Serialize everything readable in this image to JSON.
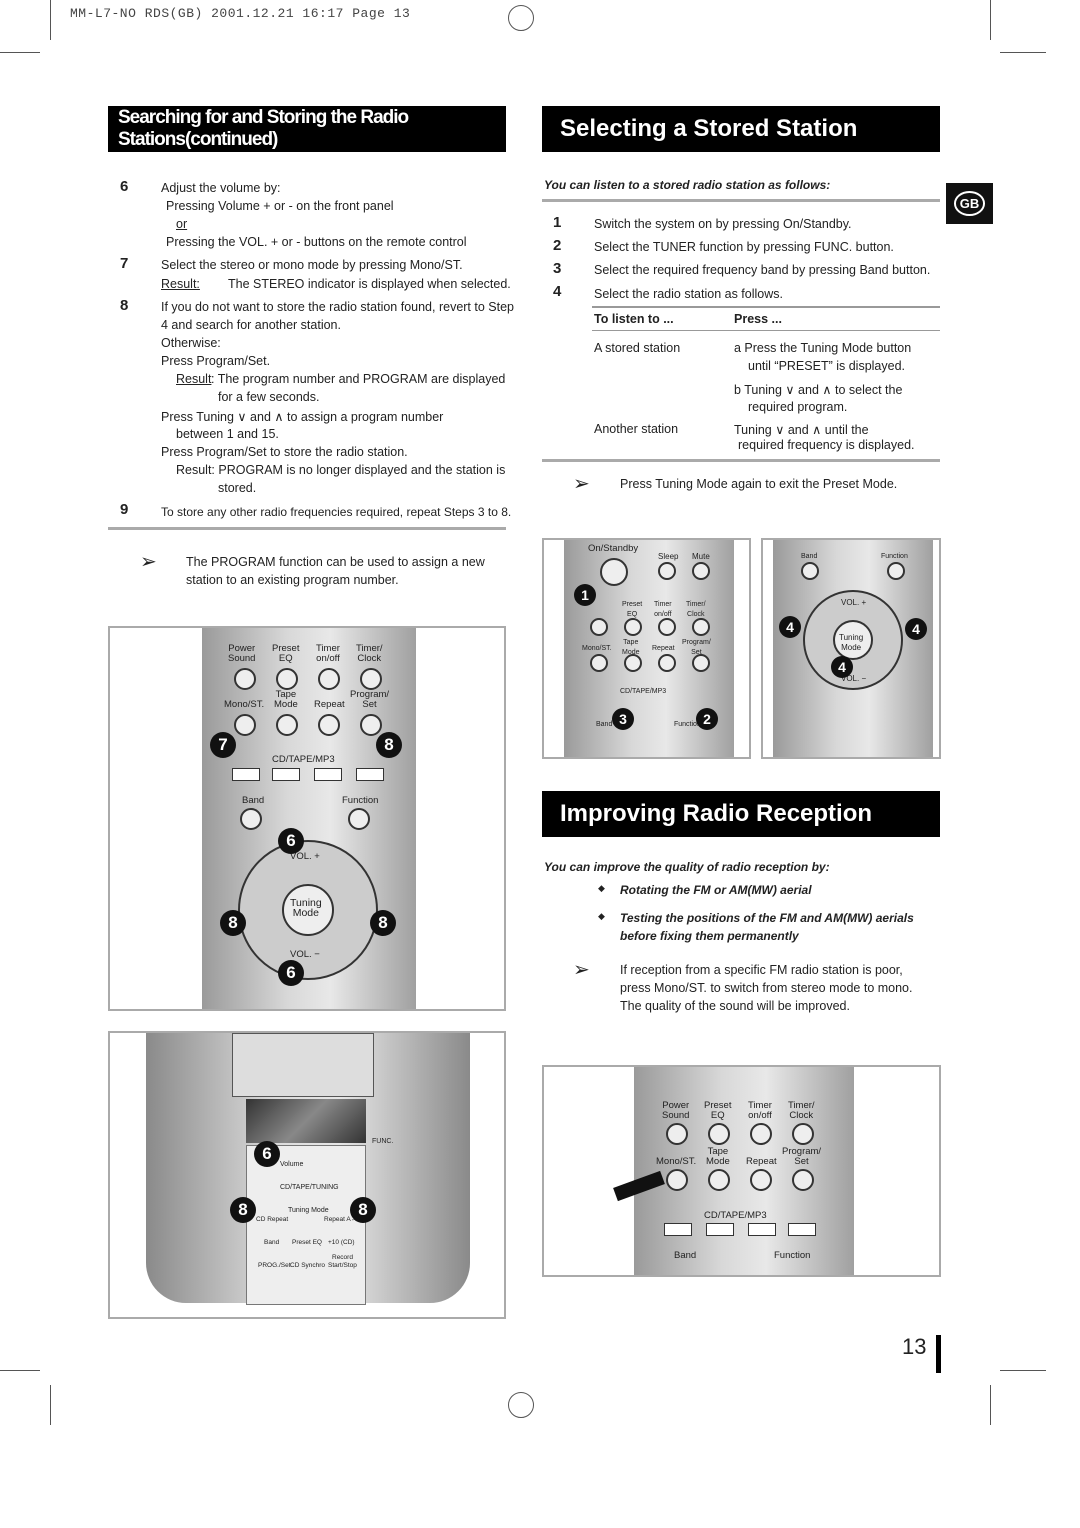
{
  "print_header": "MM-L7-NO RDS(GB)   2001.12.21   16:17   Page 13",
  "left": {
    "title": "Searching for and Storing the Radio Stations(continued)",
    "steps": [
      {
        "n": "6",
        "text": "Adjust the volume by:",
        "b1": "Pressing Volume + or - on the front panel",
        "or": "or",
        "b2": "Pressing the  VOL. + or - buttons on the remote control"
      },
      {
        "n": "7",
        "text": "Select the stereo or mono mode by pressing Mono/ST.",
        "result_label": "Result:",
        "result": "The STEREO indicator is displayed when selected."
      },
      {
        "n": "8",
        "text1": "If you do not want to store the radio station found, revert to Step",
        "text2": "4 and search for another station.",
        "otherwise": "Otherwise:",
        "a": "Press Program/Set.",
        "a_result_label": "Result",
        "a_result1": ": The program number and PROGRAM are displayed",
        "a_result2": "for a few seconds.",
        "b1": "Press  Tuning ∨ and ∧ to assign a program number",
        "b2": "between 1 and 15.",
        "c": "Press Program/Set to store the radio station.",
        "c_result1": "Result: PROGRAM is no longer displayed and the station is",
        "c_result2": "stored."
      },
      {
        "n": "9",
        "text": "To store any other radio frequencies required, repeat Steps 3 to 8."
      }
    ],
    "note1": "The PROGRAM function can be used to assign a new",
    "note2": "station to an existing program number."
  },
  "right": {
    "title": "Selecting a Stored Station",
    "intro": "You can listen to a stored radio station as follows:",
    "steps": [
      {
        "n": "1",
        "text": "Switch the system on by pressing On/Standby."
      },
      {
        "n": "2",
        "text": "Select the TUNER function by pressing FUNC. button."
      },
      {
        "n": "3",
        "text": "Select the required frequency band by pressing Band button."
      },
      {
        "n": "4",
        "text": "Select the radio station as follows."
      }
    ],
    "table": {
      "h1": "To listen to ...",
      "h2": "Press ...",
      "r1c1": "A stored station",
      "r1a1": "a  Press the Tuning Mode button",
      "r1a2": "until “PRESET” is displayed.",
      "r1b1": "b  Tuning ∨ and ∧ to select the",
      "r1b2": "required program.",
      "r2c1": "Another station",
      "r2a1": "Tuning ∨ and ∧ until the",
      "r2a2": "required frequency is displayed."
    },
    "note": "Press Tuning Mode again to exit the Preset Mode.",
    "title2": "Improving Radio Reception",
    "intro2": "You can improve the quality of radio reception by:",
    "bullets": [
      "Rotating the FM or AM(MW) aerial",
      "Testing the positions of the FM and AM(MW) aerials",
      "before fixing them permanently"
    ],
    "note2": [
      "If reception from a specific FM radio station is poor,",
      "press Mono/ST. to switch from stereo mode to mono.",
      "The quality of the sound will be improved."
    ]
  },
  "badge": "GB",
  "page_number": "13",
  "figures": {
    "remote_labels": {
      "power_sound": "Power\nSound",
      "preset_eq": "Preset\nEQ",
      "timer": "Timer\non/off",
      "timer_clock": "Timer/\nClock",
      "mono": "Mono/ST.",
      "tape_mode": "Tape\nMode",
      "repeat": "Repeat",
      "program_set": "Program/\nSet",
      "cdtape": "CD/TAPE/MP3",
      "band": "Band",
      "function": "Function",
      "vol_plus": "VOL. +",
      "vol_minus": "VOL. −",
      "tuning_mode": "Tuning\nMode",
      "on_standby": "On/Standby",
      "sleep": "Sleep",
      "mute": "Mute"
    },
    "device_labels": {
      "volume": "Volume",
      "cdtapetuning": "CD/TAPE/TUNING",
      "tuning_mode": "Tuning Mode",
      "cd_repeat": "CD Repeat",
      "repeat_ab": "Repeat A↔B",
      "band": "Band",
      "preset_eq": "Preset EQ",
      "plus10": "+10 (CD)",
      "record": "Record",
      "prog_set": "PROG./Set",
      "cd_synchro": "CD Synchro",
      "start_stop": "Start/Stop",
      "func": "FUNC."
    },
    "callouts": [
      "7",
      "8",
      "6",
      "8",
      "8",
      "6",
      "6",
      "8",
      "8",
      "1",
      "3",
      "2",
      "4",
      "4",
      "4"
    ]
  }
}
